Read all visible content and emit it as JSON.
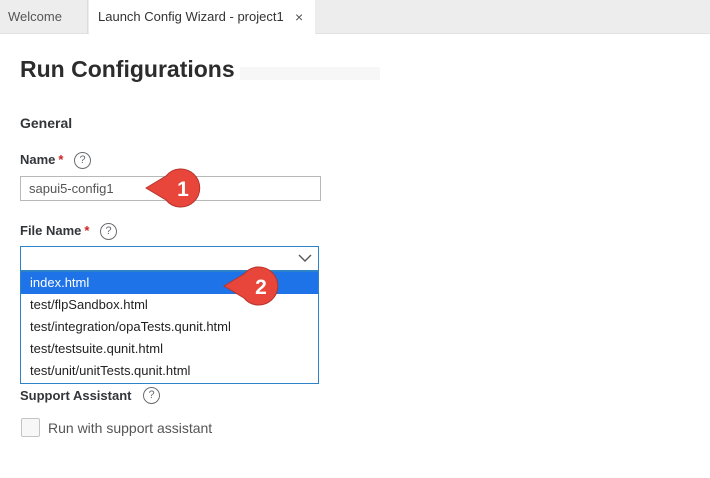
{
  "tabs": [
    {
      "label": "Welcome"
    },
    {
      "label": "Launch Config Wizard - project1",
      "close": "×"
    }
  ],
  "page": {
    "title": "Run Configurations"
  },
  "general": {
    "section_label": "General"
  },
  "name_field": {
    "label": "Name",
    "required_mark": "*",
    "help": "?",
    "value": "sapui5-config1"
  },
  "file_field": {
    "label": "File Name",
    "required_mark": "*",
    "help": "?",
    "value": "",
    "options": [
      "index.html",
      "test/flpSandbox.html",
      "test/integration/opaTests.qunit.html",
      "test/testsuite.qunit.html",
      "test/unit/unitTests.qunit.html"
    ],
    "highlighted_option": 0
  },
  "support": {
    "label": "Support Assistant",
    "help": "?",
    "checkbox_label": "Run with support assistant",
    "checked": false
  },
  "callouts": [
    {
      "number": "1"
    },
    {
      "number": "2"
    }
  ],
  "colors": {
    "accent": "#1e73e8",
    "select_border": "#2d82c8",
    "callout": "#e8463b",
    "required": "#cc2222"
  }
}
